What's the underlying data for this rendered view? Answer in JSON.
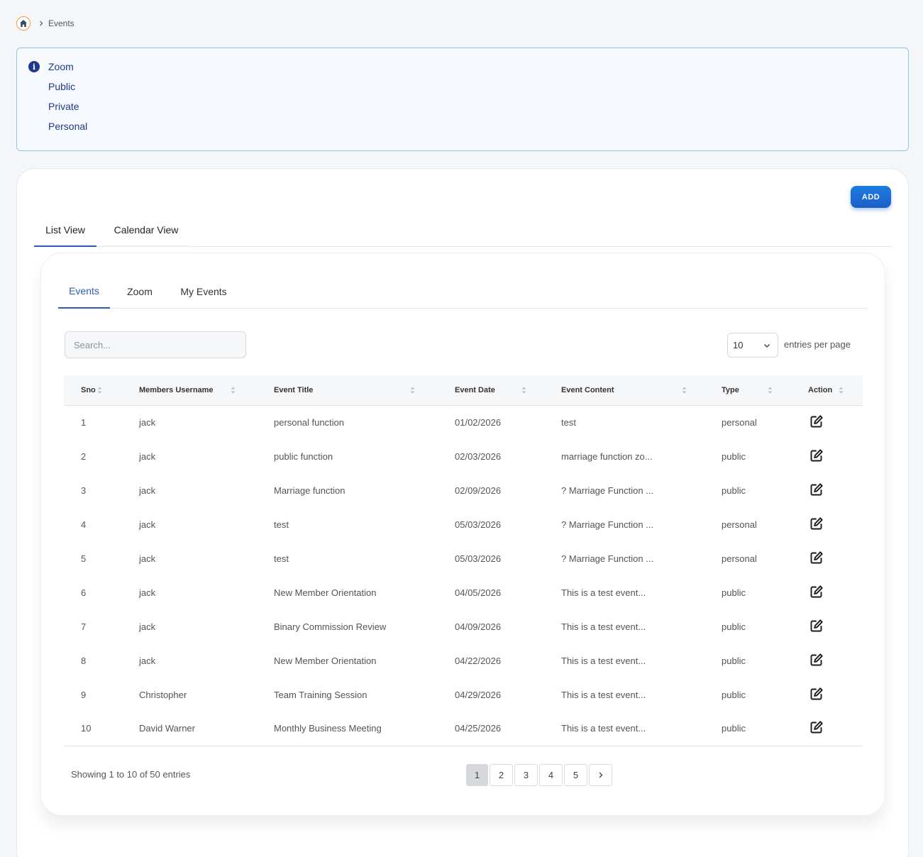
{
  "breadcrumb": {
    "current": "Events"
  },
  "info": {
    "items": [
      "Zoom",
      "Public",
      "Private",
      "Personal"
    ]
  },
  "toolbar": {
    "add_label": "ADD"
  },
  "view_tabs": [
    "List View",
    "Calendar View"
  ],
  "sub_tabs": [
    "Events",
    "Zoom",
    "My Events"
  ],
  "search": {
    "placeholder": "Search...",
    "value": ""
  },
  "per_page": {
    "value": "10",
    "label": "entries per page"
  },
  "table": {
    "headers": [
      "Sno",
      "Members Username",
      "Event Title",
      "Event Date",
      "Event Content",
      "Type",
      "Action"
    ],
    "rows": [
      [
        "1",
        "jack",
        "personal function",
        "01/02/2026",
        "test",
        "personal"
      ],
      [
        "2",
        "jack",
        "public function",
        "02/03/2026",
        "marriage function zo...",
        "public"
      ],
      [
        "3",
        "jack",
        "Marriage function",
        "02/09/2026",
        "? Marriage Function ...",
        "public"
      ],
      [
        "4",
        "jack",
        "test",
        "05/03/2026",
        "? Marriage Function ...",
        "personal"
      ],
      [
        "5",
        "jack",
        "test",
        "05/03/2026",
        "? Marriage Function ...",
        "personal"
      ],
      [
        "6",
        "jack",
        "New Member Orientation",
        "04/05/2026",
        "This is a test event...",
        "public"
      ],
      [
        "7",
        "jack",
        "Binary Commission Review",
        "04/09/2026",
        "This is a test event...",
        "public"
      ],
      [
        "8",
        "jack",
        "New Member Orientation",
        "04/22/2026",
        "This is a test event...",
        "public"
      ],
      [
        "9",
        "Christopher",
        "Team Training Session",
        "04/29/2026",
        "This is a test event...",
        "public"
      ],
      [
        "10",
        "David Warner",
        "Monthly Business Meeting",
        "04/25/2026",
        "This is a test event...",
        "public"
      ]
    ]
  },
  "footer": {
    "showing": "Showing 1 to 10 of 50 entries",
    "pages": [
      "1",
      "2",
      "3",
      "4",
      "5"
    ]
  },
  "icons": {
    "home": "home-icon",
    "info": "info-icon",
    "edit": "edit-icon",
    "sort": "sort-icon",
    "next": "chevron-right-icon"
  },
  "colors": {
    "primary": "#1a5fc9",
    "info_text": "#1e3a8a",
    "info_border": "#8ec6e6",
    "accent": "#e2a13b"
  }
}
